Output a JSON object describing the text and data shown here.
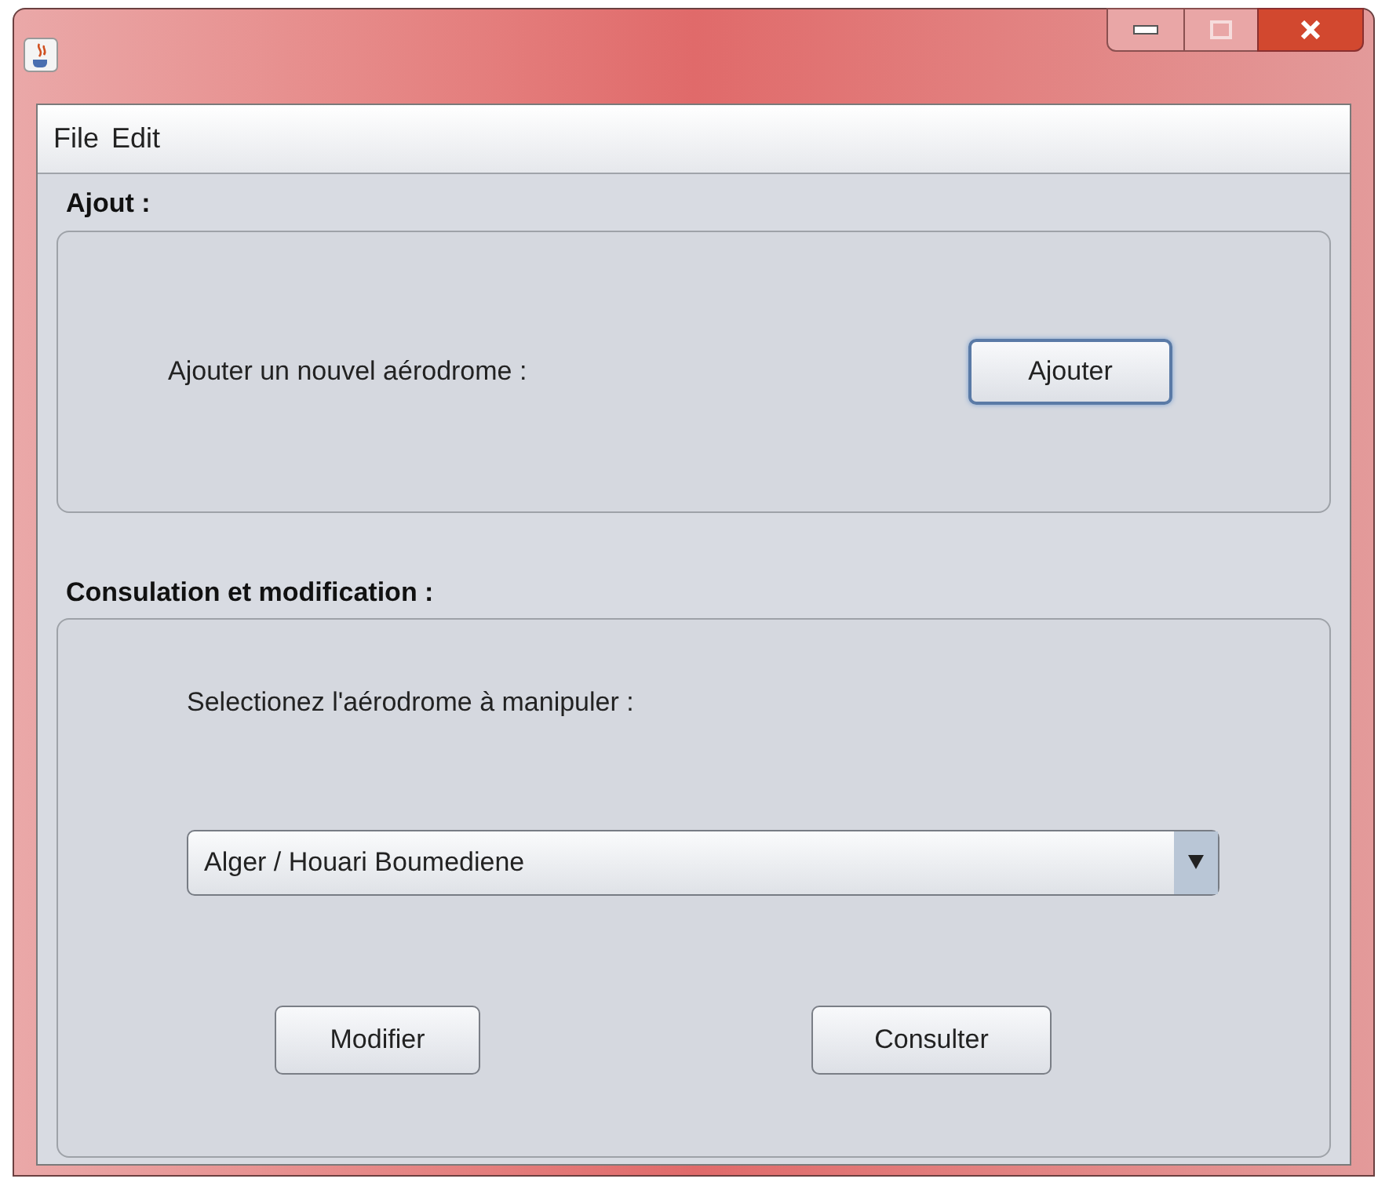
{
  "menu": [
    "File",
    "Edit"
  ],
  "add_section": {
    "title": "Ajout :",
    "label": "Ajouter un nouvel aérodrome :",
    "button": {
      "label": "Ajouter",
      "focused": true
    }
  },
  "consult_section": {
    "title": "Consulation et modification :",
    "label": "Selectionez l'aérodrome à manipuler :",
    "combo": {
      "value": "Alger / Houari Boumediene"
    },
    "buttons": [
      "Modifier",
      "Consulter"
    ]
  }
}
